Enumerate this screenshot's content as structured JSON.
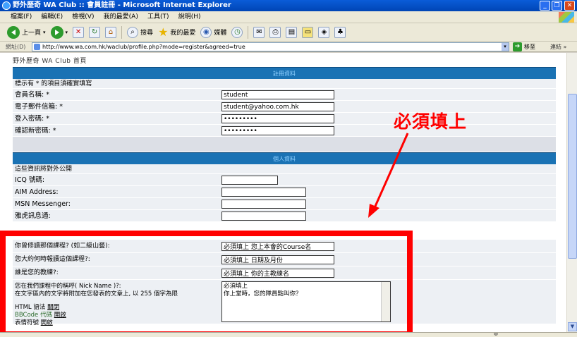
{
  "window": {
    "title": "野外歷奇 WA Club :: 會員註冊 - Microsoft Internet Explorer"
  },
  "menu": [
    "檔案(F)",
    "編輯(E)",
    "檢視(V)",
    "我的最愛(A)",
    "工具(T)",
    "說明(H)"
  ],
  "toolbar": {
    "back": "上一頁",
    "search": "搜尋",
    "favorites": "我的最愛",
    "media": "媒體"
  },
  "address": {
    "label": "網址(D)",
    "url": "http://www.wa.com.hk/waclub/profile.php?mode=register&agreed=true",
    "go": "移至",
    "links": "連結"
  },
  "page": {
    "site_nav": "野外歷奇 WA Club 首頁",
    "required_note": "標示有 * 的項目須確實填寫",
    "public_note": "這些資訊將對外公開"
  },
  "required_fields": [
    {
      "label": "會員名稱: *",
      "value": "student"
    },
    {
      "label": "電子郵件信箱: *",
      "value": "student@yahoo.com.hk"
    },
    {
      "label": "登入密碼: *",
      "value": "•••••••••"
    },
    {
      "label": "確認新密碼: *",
      "value": "•••••••••"
    }
  ],
  "profile_fields": [
    {
      "label": "ICQ 號碼:",
      "value": ""
    },
    {
      "label": "AIM Address:",
      "value": ""
    },
    {
      "label": "MSN Messenger:",
      "value": ""
    },
    {
      "label": "雅虎訊息通:",
      "value": ""
    }
  ],
  "course_fields": [
    {
      "label": "你曾修讀那個課程? (如二級山藝):",
      "value": "必須填上 您上本會的Course名"
    },
    {
      "label": "您大約何時報讀這個課程?:",
      "value": "必須填上 日期及月份"
    },
    {
      "label": "誰是您的教練?:",
      "value": "必須填上 你的主教練名"
    }
  ],
  "nickname": {
    "label": "您在我們課程中的稱呼( Nick Name )?:",
    "hint": "在文字區內的文字將附加在您發表的文章上, 以 255 個字為限",
    "html_label": "HTML 語法",
    "html_state": "關閉",
    "bbcode_label": "BBCode 代碼",
    "bbcode_state": "開啟",
    "smilies_label": "表情符號",
    "smilies_state": "開啟",
    "value": "必須填上\n你上堂時，您的隊員點叫你？"
  },
  "annotation": {
    "text": "必須填上"
  },
  "colors": {
    "section_header": "#1a72b4",
    "row_bg": "#edf0f4",
    "highlight": "#ff0000"
  }
}
